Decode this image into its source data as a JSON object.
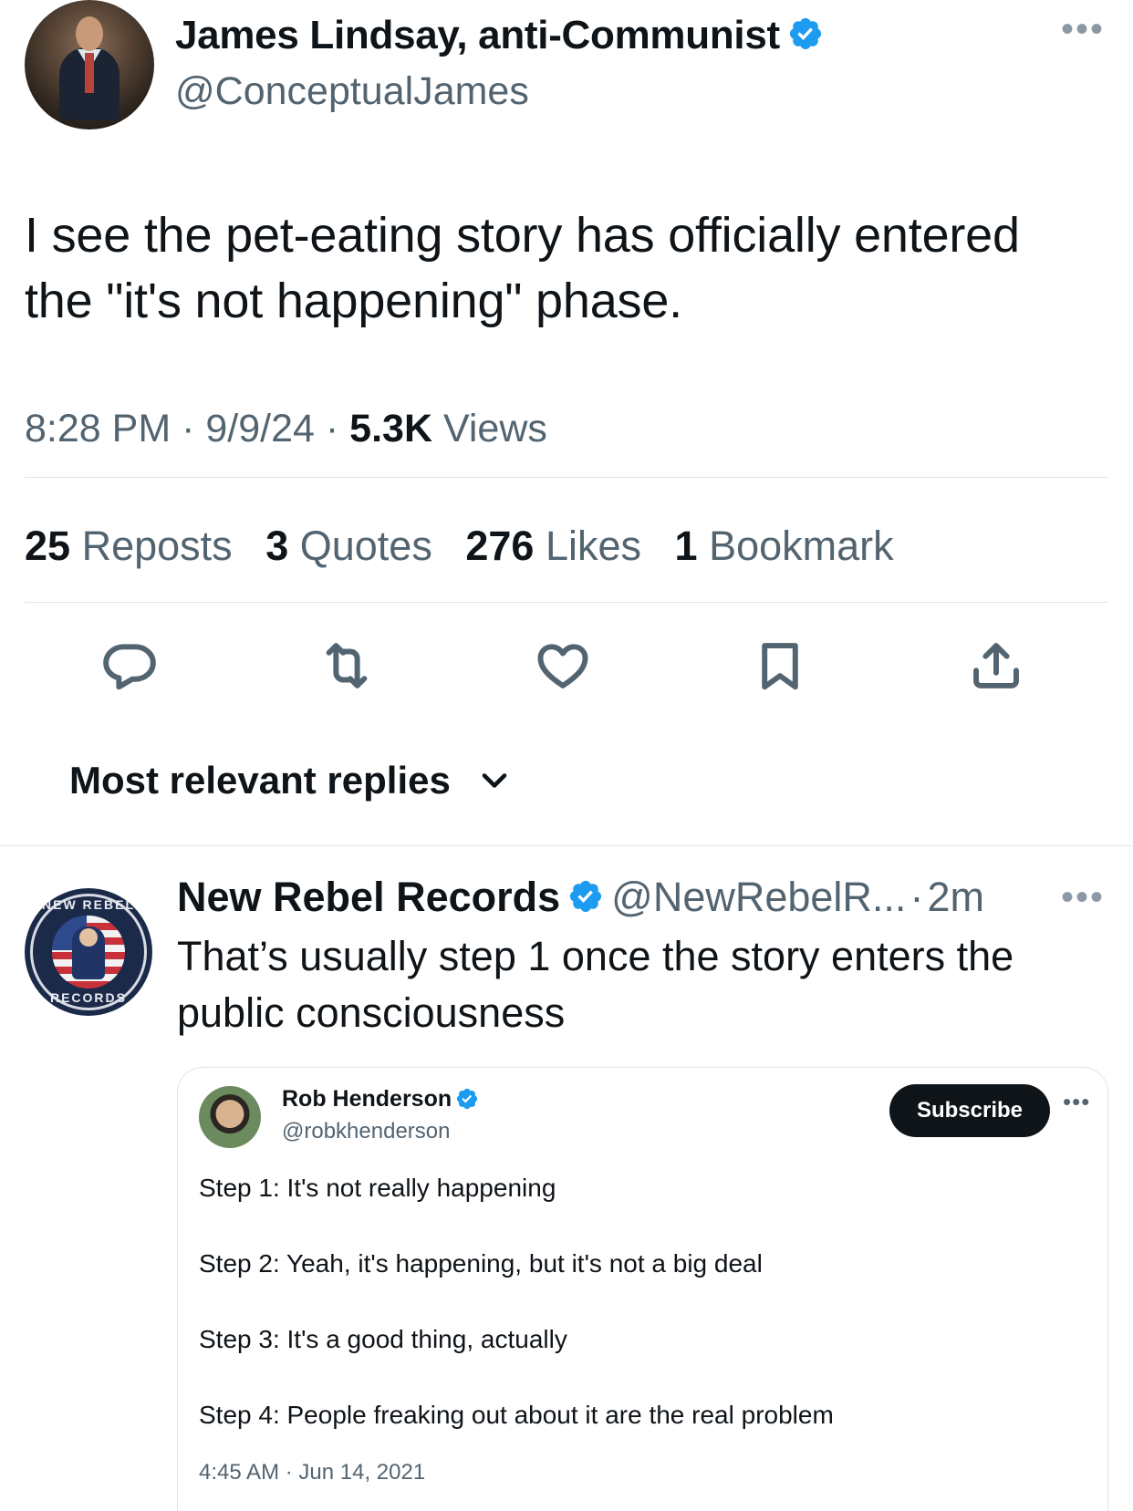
{
  "tweet": {
    "author_name": "James Lindsay, anti-Communist",
    "author_handle": "@ConceptualJames",
    "more_label": "•••",
    "text_line1": "I see the pet-eating story has officially entered",
    "text_line2": "the \"it's not happening\" phase.",
    "time": "8:28 PM",
    "date": "9/9/24",
    "views_count": "5.3K",
    "views_label": "Views",
    "separator": "·"
  },
  "stats": {
    "reposts_count": "25",
    "reposts_label": "Reposts",
    "quotes_count": "3",
    "quotes_label": "Quotes",
    "likes_count": "276",
    "likes_label": "Likes",
    "bookmarks_count": "1",
    "bookmarks_label": "Bookmark"
  },
  "actions": [
    "reply-icon",
    "repost-icon",
    "like-icon",
    "bookmark-icon",
    "share-icon"
  ],
  "replies_sort": {
    "label": "Most relevant replies"
  },
  "reply": {
    "author_name": "New Rebel Records",
    "author_handle": "@NewRebelR...",
    "age": "2m",
    "separator": "·",
    "more_label": "•••",
    "text_line1": "That’s usually step 1 once the story enters the",
    "text_line2": "public consciousness",
    "avatar_text_top": "NEW REBEL",
    "avatar_text_bottom": "RECORDS"
  },
  "embed": {
    "author_name": "Rob Henderson",
    "author_handle": "@robkhenderson",
    "subscribe_label": "Subscribe",
    "more_label": "•••",
    "steps": [
      "Step 1: It's not really happening",
      "Step 2: Yeah, it's happening, but it's not a big deal",
      "Step 3: It's a good thing, actually",
      "Step 4: People freaking out about it are the real problem"
    ],
    "timestamp": "4:45 AM · Jun 14, 2021"
  },
  "colors": {
    "text": "#0f1419",
    "muted": "#536471",
    "verified": "#1d9bf0",
    "divider": "#e1e6ea"
  }
}
